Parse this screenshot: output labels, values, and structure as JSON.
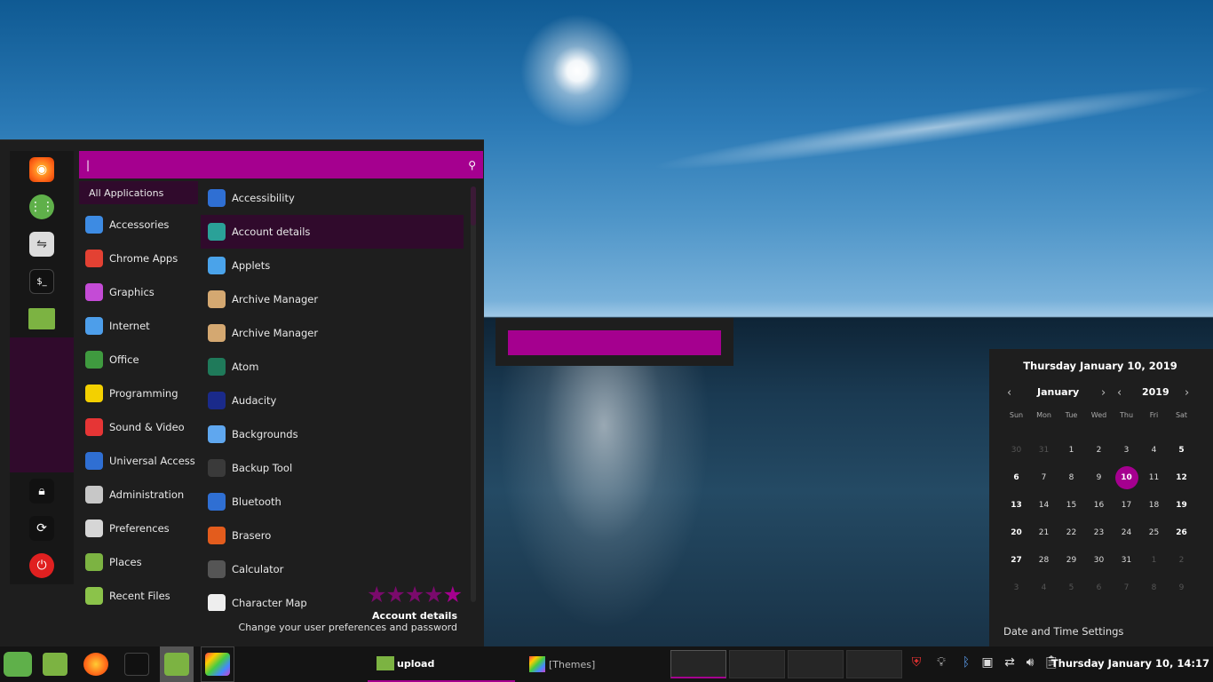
{
  "search": {
    "value": "|"
  },
  "favorites": [
    {
      "name": "firefox"
    },
    {
      "name": "apps-grid"
    },
    {
      "name": "settings-toggles"
    },
    {
      "name": "terminal",
      "label": "$_"
    },
    {
      "name": "files"
    }
  ],
  "session": [
    {
      "name": "lock"
    },
    {
      "name": "logout"
    },
    {
      "name": "power"
    }
  ],
  "categories": [
    {
      "label": "All Applications",
      "color": "transparent"
    },
    {
      "label": "Accessories",
      "color": "#3d8be3"
    },
    {
      "label": "Chrome Apps",
      "color": "#e34133"
    },
    {
      "label": "Graphics",
      "color": "#c44bd6"
    },
    {
      "label": "Internet",
      "color": "#4d9eea"
    },
    {
      "label": "Office",
      "color": "#3f9a3f"
    },
    {
      "label": "Programming",
      "color": "#f3d000"
    },
    {
      "label": "Sound & Video",
      "color": "#e63535"
    },
    {
      "label": "Universal Access",
      "color": "#2f6fd3"
    },
    {
      "label": "Administration",
      "color": "#c7c7c7"
    },
    {
      "label": "Preferences",
      "color": "#d6d6d6"
    },
    {
      "label": "Places",
      "color": "#7cb342"
    },
    {
      "label": "Recent Files",
      "color": "#8bc34a"
    }
  ],
  "apps": [
    {
      "label": "Accessibility",
      "color": "#2f6fd3"
    },
    {
      "label": "Account details",
      "color": "#2aa198"
    },
    {
      "label": "Applets",
      "color": "#4aa3ea"
    },
    {
      "label": "Archive Manager",
      "color": "#d4a871"
    },
    {
      "label": "Archive Manager",
      "color": "#d4a871"
    },
    {
      "label": "Atom",
      "color": "#1f7a5a"
    },
    {
      "label": "Audacity",
      "color": "#1a2a8a"
    },
    {
      "label": "Backgrounds",
      "color": "#5fa7ef"
    },
    {
      "label": "Backup Tool",
      "color": "#3a3a3a"
    },
    {
      "label": "Bluetooth",
      "color": "#2f6fd3"
    },
    {
      "label": "Brasero",
      "color": "#e35c1d"
    },
    {
      "label": "Calculator",
      "color": "#555555"
    },
    {
      "label": "Character Map",
      "color": "#eeeeee"
    }
  ],
  "info": {
    "title": "Account details",
    "description": "Change your user preferences and password"
  },
  "calendar": {
    "full_date": "Thursday January 10, 2019",
    "month": "January",
    "year": "2019",
    "day_names": [
      "Sun",
      "Mon",
      "Tue",
      "Wed",
      "Thu",
      "Fri",
      "Sat"
    ],
    "days": [
      {
        "n": "30",
        "o": 1
      },
      {
        "n": "31",
        "o": 1
      },
      {
        "n": "1"
      },
      {
        "n": "2"
      },
      {
        "n": "3"
      },
      {
        "n": "4"
      },
      {
        "n": "5",
        "w": 1
      },
      {
        "n": "6",
        "w": 1
      },
      {
        "n": "7"
      },
      {
        "n": "8"
      },
      {
        "n": "9"
      },
      {
        "n": "10",
        "t": 1
      },
      {
        "n": "11"
      },
      {
        "n": "12",
        "w": 1
      },
      {
        "n": "13",
        "w": 1
      },
      {
        "n": "14"
      },
      {
        "n": "15"
      },
      {
        "n": "16"
      },
      {
        "n": "17"
      },
      {
        "n": "18"
      },
      {
        "n": "19",
        "w": 1
      },
      {
        "n": "20",
        "w": 1
      },
      {
        "n": "21"
      },
      {
        "n": "22"
      },
      {
        "n": "23"
      },
      {
        "n": "24"
      },
      {
        "n": "25"
      },
      {
        "n": "26",
        "w": 1
      },
      {
        "n": "27",
        "w": 1
      },
      {
        "n": "28"
      },
      {
        "n": "29"
      },
      {
        "n": "30"
      },
      {
        "n": "31"
      },
      {
        "n": "1",
        "o": 1
      },
      {
        "n": "2",
        "o": 1
      },
      {
        "n": "3",
        "o": 1
      },
      {
        "n": "4",
        "o": 1
      },
      {
        "n": "5",
        "o": 1
      },
      {
        "n": "6",
        "o": 1
      },
      {
        "n": "7",
        "o": 1
      },
      {
        "n": "8",
        "o": 1
      },
      {
        "n": "9",
        "o": 1
      }
    ],
    "settings_label": "Date and Time Settings"
  },
  "taskbar": {
    "windows": [
      {
        "label": "upload",
        "icon": "folder-icon"
      },
      {
        "label": "[Themes]",
        "icon": "paint-icon"
      }
    ],
    "clock": "Thursday January 10, 14:17"
  },
  "colors": {
    "accent": "#a5008f",
    "accent_dark": "#300a2c",
    "panel": "#1e1e1e"
  }
}
